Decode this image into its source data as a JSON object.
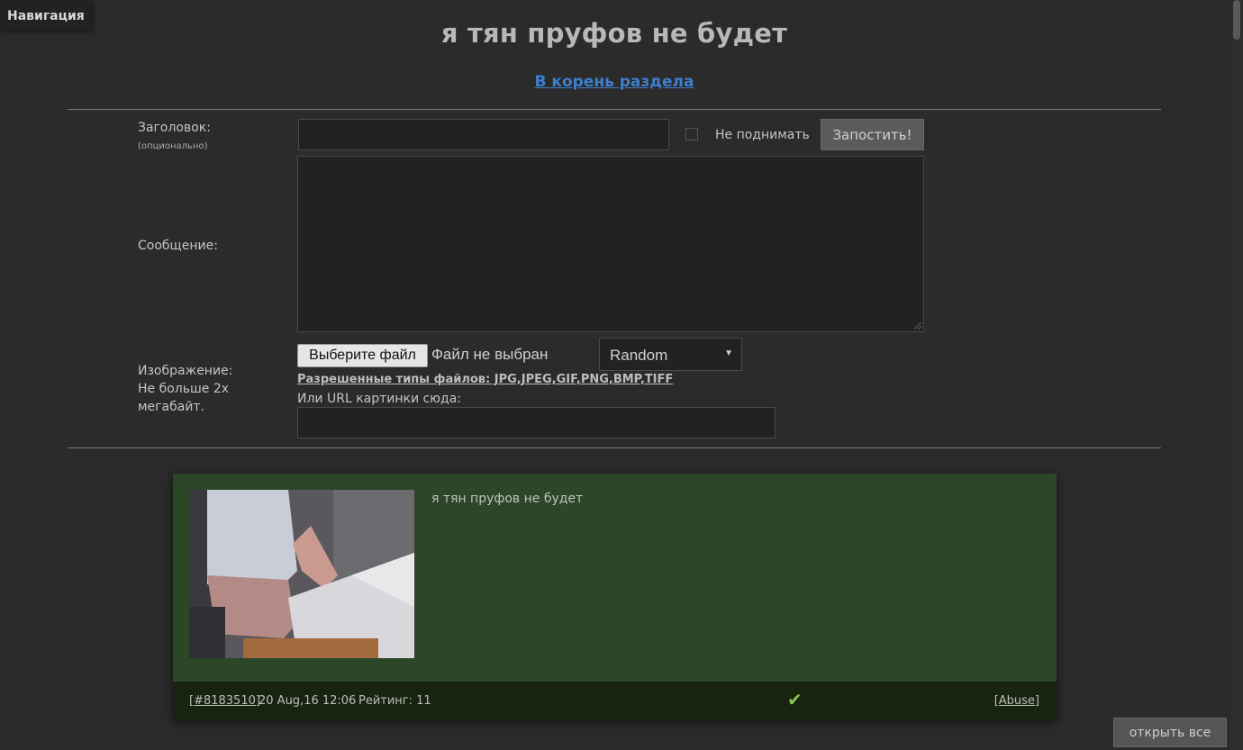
{
  "navigation": {
    "label": "Навигация"
  },
  "thread": {
    "title": "я тян пруфов не будет"
  },
  "root_link": {
    "label": "В корень раздела"
  },
  "form": {
    "subject_label": "Заголовок:",
    "subject_hint": "(опционально)",
    "subject_value": "",
    "nobump_label": "Не поднимать",
    "nobump_checked": false,
    "submit_label": "Запостить!",
    "message_label": "Сообщение:",
    "message_value": "",
    "image_label_1": "Изображение:",
    "image_label_2": "Не больше 2х",
    "image_label_3": "мегабайт.",
    "file_button_label": "Выберите файл",
    "file_status": "Файл не выбран",
    "select_value": "Random",
    "allowed_types": "Разрешенные типы файлов: JPG,JPEG,GIF,PNG,BMP,TIFF",
    "url_label": "Или URL картинки сюда:",
    "url_value": ""
  },
  "post": {
    "text": "я тян пруфов не будет",
    "id_label": "[#8183510]",
    "date": "20 Aug,16 12:06",
    "rating": "Рейтинг: 11",
    "check_icon": "check-icon",
    "abuse_label": "[Abuse]"
  },
  "open_all": {
    "label": "открыть все"
  },
  "colors": {
    "background": "#2b2b2b",
    "post_background": "#2c4628",
    "post_footer": "#17240f",
    "link": "#3f7fcf",
    "check": "#8bc34a"
  }
}
